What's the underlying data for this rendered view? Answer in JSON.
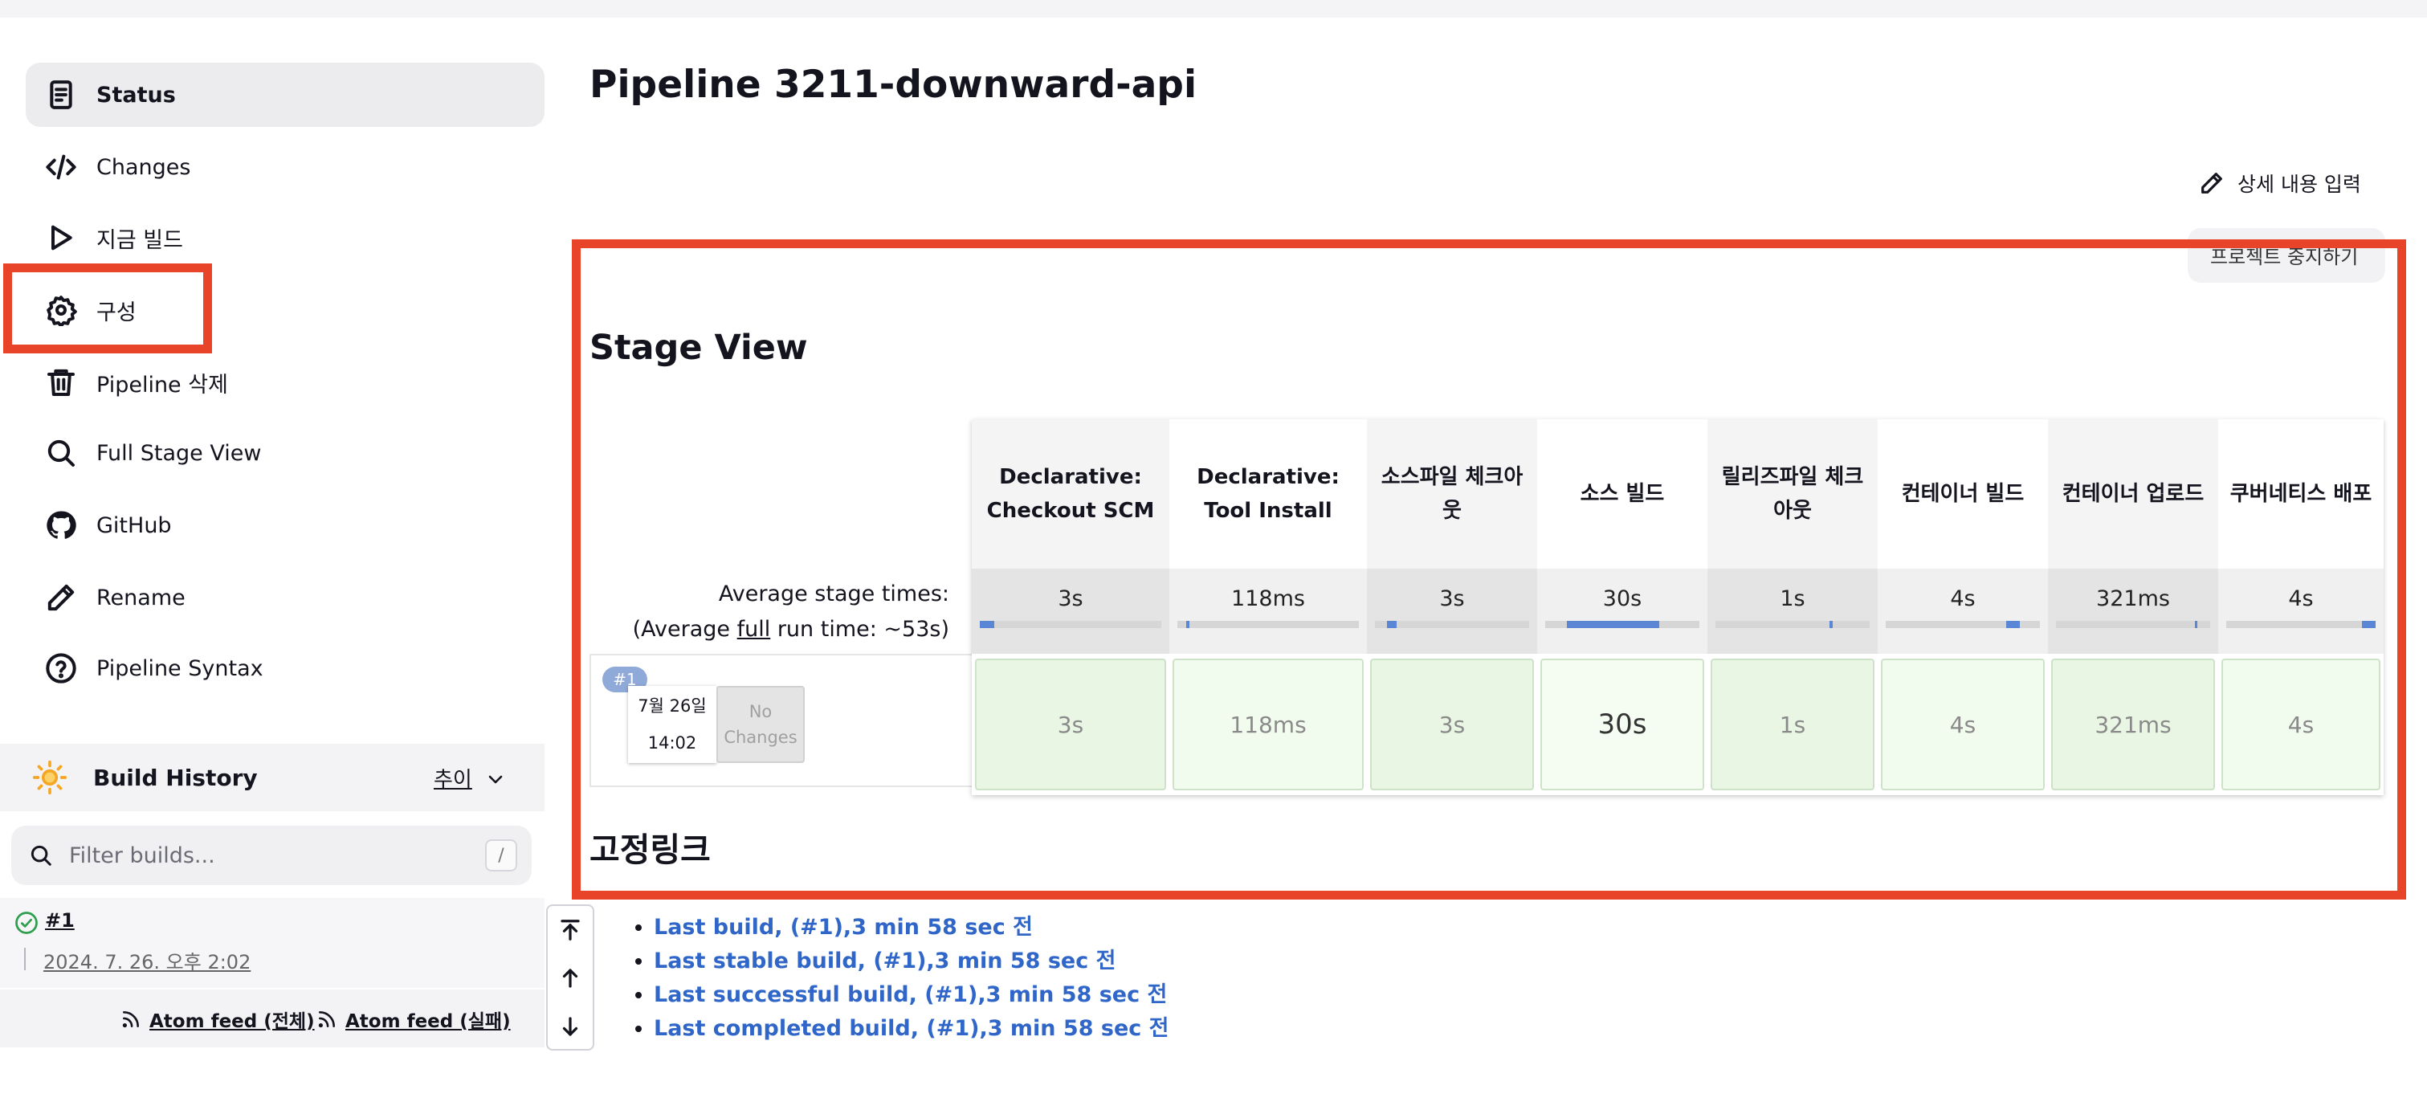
{
  "sidebar": {
    "items": [
      {
        "label": "Status",
        "icon": "document-icon"
      },
      {
        "label": "Changes",
        "icon": "code-icon"
      },
      {
        "label": "지금 빌드",
        "icon": "play-icon"
      },
      {
        "label": "구성",
        "icon": "gear-icon"
      },
      {
        "label": "Pipeline 삭제",
        "icon": "trash-icon"
      },
      {
        "label": "Full Stage View",
        "icon": "search-icon"
      },
      {
        "label": "GitHub",
        "icon": "github-icon"
      },
      {
        "label": "Rename",
        "icon": "pencil-icon"
      },
      {
        "label": "Pipeline Syntax",
        "icon": "help-circle-icon"
      }
    ],
    "active_index": 0
  },
  "build_history": {
    "title": "Build History",
    "add_label": "추이",
    "filter_placeholder": "Filter builds...",
    "filter_shortcut": "/",
    "builds": [
      {
        "number": "#1",
        "date": "2024. 7. 26. 오후 2:02",
        "status": "success"
      }
    ],
    "feeds": {
      "all": "Atom feed (전체)",
      "failed": "Atom feed (실패)"
    }
  },
  "main": {
    "title": "Pipeline 3211-downward-api",
    "edit_description": "상세 내용 입력",
    "hidden_button": "프로젝트 중지하기"
  },
  "stage_view": {
    "title": "Stage View",
    "avg_label_line1": "Average stage times:",
    "avg_label_line2_prefix": "(Average ",
    "avg_label_line2_link": "full",
    "avg_label_line2_suffix": " run time: ~53s)",
    "stages": [
      {
        "name": "Declarative: Checkout SCM",
        "avg": "3s",
        "run": "3s",
        "bar_start": 0.0,
        "bar_frac": 0.08
      },
      {
        "name": "Declarative: Tool Install",
        "avg": "118ms",
        "run": "118ms",
        "bar_start": 0.05,
        "bar_frac": 0.01
      },
      {
        "name": "소스파일 체크아웃",
        "avg": "3s",
        "run": "3s",
        "bar_start": 0.08,
        "bar_frac": 0.06
      },
      {
        "name": "소스 빌드",
        "avg": "30s",
        "run": "30s",
        "bar_start": 0.14,
        "bar_frac": 0.6
      },
      {
        "name": "릴리즈파일 체크아웃",
        "avg": "1s",
        "run": "1s",
        "bar_start": 0.74,
        "bar_frac": 0.02
      },
      {
        "name": "컨테이너 빌드",
        "avg": "4s",
        "run": "4s",
        "bar_start": 0.78,
        "bar_frac": 0.09
      },
      {
        "name": "컨테이너 업로드",
        "avg": "321ms",
        "run": "321ms",
        "bar_start": 0.9,
        "bar_frac": 0.01
      },
      {
        "name": "쿠버네티스 배포",
        "avg": "4s",
        "run": "4s",
        "bar_start": 0.91,
        "bar_frac": 0.09
      }
    ],
    "run": {
      "badge": "#1",
      "date": "7월 26일",
      "time": "14:02",
      "no_changes": "No Changes"
    }
  },
  "permalinks": {
    "title": "고정링크",
    "links": [
      "Last build, (#1),3 min 58 sec 전",
      "Last stable build, (#1),3 min 58 sec 전",
      "Last successful build, (#1),3 min 58 sec 전",
      "Last completed build, (#1),3 min 58 sec 전"
    ]
  },
  "colors": {
    "highlight": "#e8442a",
    "link": "#2f66c8",
    "stage_success_bg": "#e8f6e3",
    "timing_bar": "#5b86d6"
  }
}
